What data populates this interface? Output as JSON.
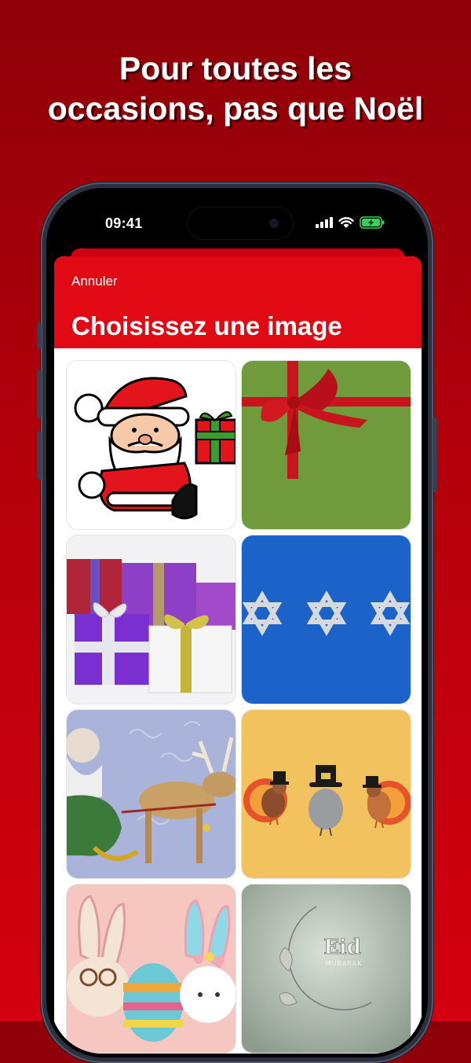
{
  "headline": {
    "line1": "Pour toutes les",
    "line2": "occasions, pas que Noël"
  },
  "status_bar": {
    "time": "09:41",
    "icons": [
      "cellular-signal-icon",
      "wifi-icon",
      "battery-charging-icon"
    ]
  },
  "sheet": {
    "cancel_label": "Annuler",
    "title": "Choisissez une image",
    "header_color": "#e10a14"
  },
  "images": [
    {
      "subject": "santa-claus-drawing"
    },
    {
      "subject": "green-gift-red-ribbon"
    },
    {
      "subject": "purple-and-white-gift-boxes"
    },
    {
      "subject": "stars-of-david-on-blue"
    },
    {
      "subject": "santa-sleigh-reindeer"
    },
    {
      "subject": "thanksgiving-turkeys"
    },
    {
      "subject": "easter-bunnies-and-eggs"
    },
    {
      "subject": "eid-crescent",
      "text": "Eid",
      "subtext": "MUBARAK"
    }
  ],
  "colors": {
    "background_top": "#8e0008",
    "background_bottom": "#d4000f",
    "accent": "#e10a14"
  }
}
